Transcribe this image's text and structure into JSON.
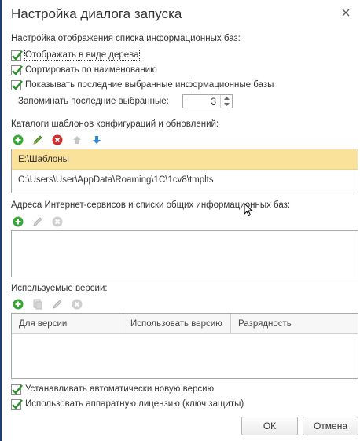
{
  "window": {
    "title": "Настройка диалога запуска",
    "close_icon": "close-icon"
  },
  "list_display": {
    "heading": "Настройка отображения списка информационных баз:",
    "checkboxes": [
      {
        "label": "Отображать в виде дерева",
        "checked": true
      },
      {
        "label": "Сортировать по наименованию",
        "checked": true
      },
      {
        "label": "Показывать последние выбранные информационные базы",
        "checked": true
      }
    ],
    "remember_label": "Запоминать последние выбранные:",
    "remember_value": "3"
  },
  "templates": {
    "heading": "Каталоги шаблонов конфигураций и обновлений:",
    "toolbar_icons": [
      "add-icon",
      "edit-icon",
      "delete-icon",
      "move-up-icon",
      "move-down-icon"
    ],
    "items": [
      "E:\\Шаблоны",
      "C:\\Users\\User\\AppData\\Roaming\\1C\\1cv8\\tmplts"
    ]
  },
  "internet_services": {
    "heading": "Адреса Интернет-сервисов и списки общих информационных баз:",
    "toolbar_icons": [
      "add-icon",
      "edit-icon",
      "delete-icon"
    ]
  },
  "versions": {
    "heading": "Используемые версии:",
    "toolbar_icons": [
      "add-icon",
      "copy-icon",
      "edit-icon",
      "delete-icon"
    ],
    "columns": [
      "Для версии",
      "Использовать версию",
      "Разрядность"
    ]
  },
  "options": [
    {
      "label": "Устанавливать автоматически новую версию",
      "checked": true
    },
    {
      "label": "Использовать аппаратную лицензию (ключ защиты)",
      "checked": true
    }
  ],
  "buttons": {
    "ok": "ОК",
    "cancel": "Отмена"
  },
  "colors": {
    "selected_row": "#fbe29a",
    "add_green": "#3aa53a",
    "delete_red": "#d42a2a",
    "arrow_blue": "#2e8ad8",
    "window_border": "#1e3f73"
  }
}
